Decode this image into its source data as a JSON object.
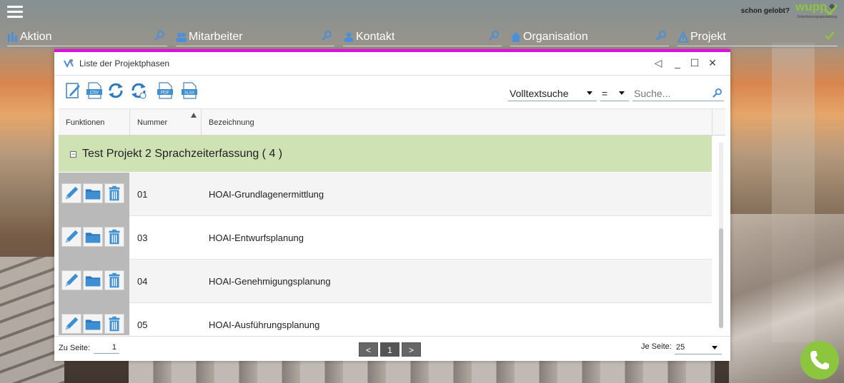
{
  "header": {
    "praise_text": "schon gelobt?",
    "logo_text": "wupp",
    "logo_subtext": "Zeiterfassungsgestaltung"
  },
  "nav": {
    "items": [
      {
        "label": "Aktion",
        "icon": "chart-bars-icon"
      },
      {
        "label": "Mitarbeiter",
        "icon": "people-icon"
      },
      {
        "label": "Kontakt",
        "icon": "contact-icon"
      },
      {
        "label": "Organisation",
        "icon": "house-icon"
      },
      {
        "label": "Projekt",
        "icon": "project-triangle-icon"
      }
    ]
  },
  "window": {
    "title": "Liste der Projektphasen",
    "controls": [
      "◁",
      "_",
      "☐",
      "✕"
    ],
    "accent_color": "#e20be2"
  },
  "toolbar": {
    "buttons": [
      "edit-new-icon",
      "csv-export-icon",
      "refresh-icon",
      "refresh-alt-icon",
      "pdf-export-icon",
      "xlsx-export-icon"
    ],
    "filter_mode": "Volltextsuche",
    "operator": "=",
    "search_placeholder": "Suche..."
  },
  "grid": {
    "columns": [
      "Funktionen",
      "Nummer",
      "Bezeichnung"
    ],
    "group": {
      "label": "Test Projekt 2 Sprachzeiterfassung ( 4 )",
      "color": "#cfe2b4"
    },
    "rows": [
      {
        "nummer": "01",
        "bezeichnung": "HOAI-Grundlagenermittlung"
      },
      {
        "nummer": "03",
        "bezeichnung": "HOAI-Entwurfsplanung"
      },
      {
        "nummer": "04",
        "bezeichnung": "HOAI-Genehmigungsplanung"
      },
      {
        "nummer": "05",
        "bezeichnung": "HOAI-Ausführungsplanung"
      }
    ]
  },
  "footer": {
    "goto_label": "Zu Seite:",
    "goto_value": "1",
    "prev": "<",
    "current_page": "1",
    "next": ">",
    "per_page_label": "Je Seite:",
    "per_page_value": "25"
  },
  "colors": {
    "brand_green": "#8cc63f",
    "icon_blue": "#3d8fd1"
  }
}
